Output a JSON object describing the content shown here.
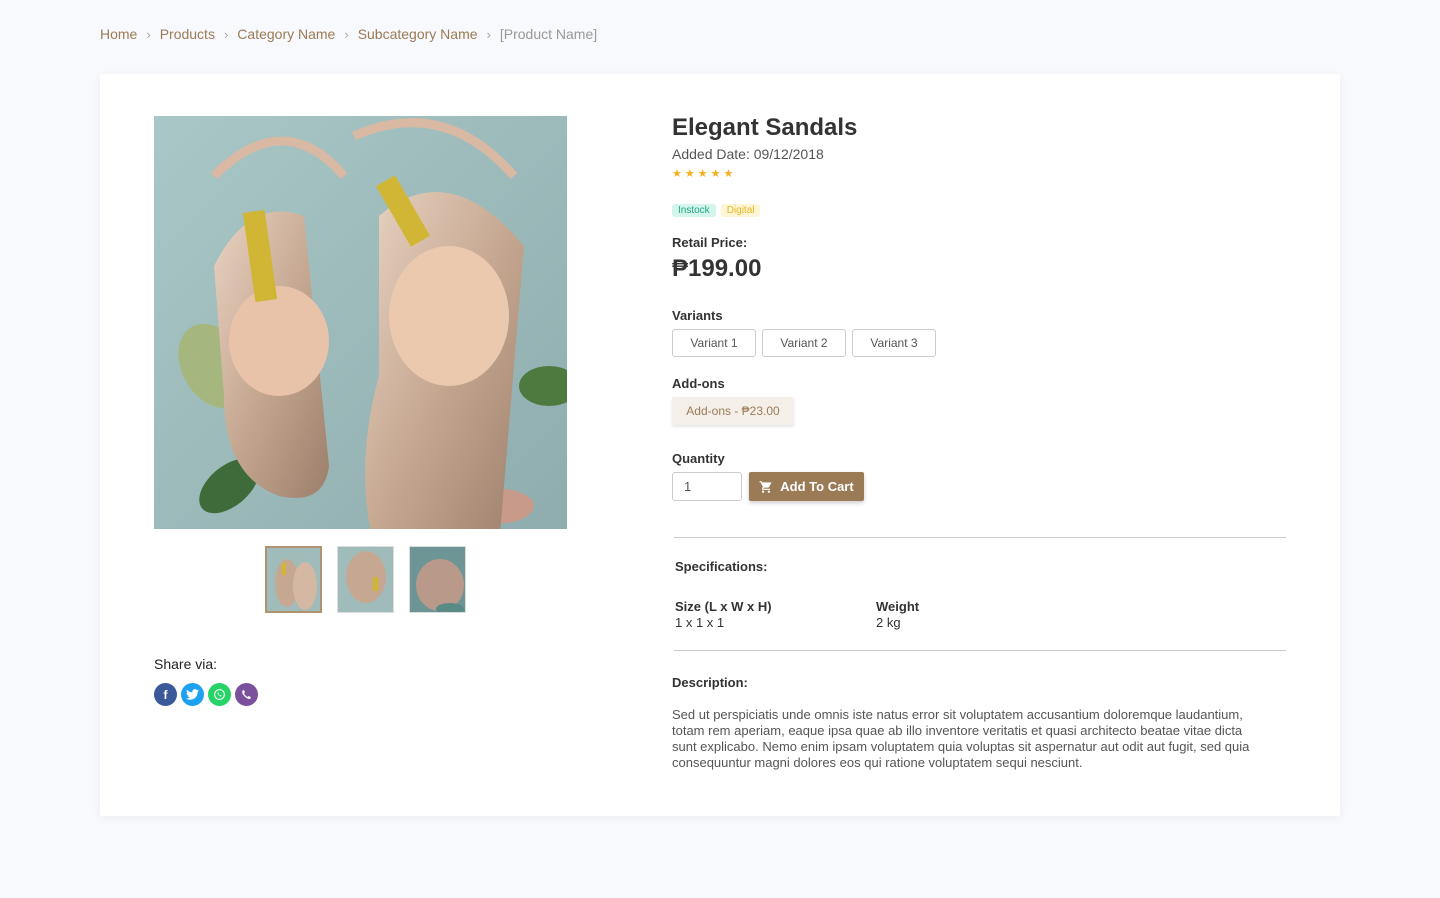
{
  "breadcrumb": {
    "items": [
      "Home",
      "Products",
      "Category Name",
      "Subcategory Name"
    ],
    "current": "[Product Name]",
    "separator": "›"
  },
  "product": {
    "title": "Elegant Sandals",
    "added_date": "Added Date: 09/12/2018",
    "rating": 5,
    "badges": [
      "Instock",
      "Digital"
    ],
    "retail_label": "Retail Price:",
    "price": "₱199.00",
    "variants_label": "Variants",
    "variants": [
      "Variant 1",
      "Variant 2",
      "Variant 3"
    ],
    "addons_label": "Add-ons",
    "addon": "Add-ons - ₱23.00",
    "quantity_label": "Quantity",
    "quantity_value": "1",
    "cart_button": "Add To Cart"
  },
  "specs": {
    "title": "Specifications:",
    "size_label": "Size (L x W x H)",
    "size_value": "1 x 1 x 1",
    "weight_label": "Weight",
    "weight_value": "2 kg"
  },
  "description": {
    "title": "Description:",
    "text": "Sed ut perspiciatis unde omnis iste natus error sit voluptatem accusantium doloremque laudantium, totam rem aperiam, eaque ipsa quae ab illo inventore veritatis et quasi architecto beatae vitae dicta sunt explicabo. Nemo enim ipsam voluptatem quia voluptas sit aspernatur aut odit aut fugit, sed quia consequuntur magni dolores eos qui ratione voluptatem sequi nesciunt."
  },
  "share": {
    "label": "Share via:",
    "icons": [
      "facebook-icon",
      "twitter-icon",
      "whatsapp-icon",
      "viber-icon"
    ]
  },
  "colors": {
    "accent": "#9a7b56",
    "star": "#f6b01e",
    "instock": "#1fa884",
    "digital": "#e8b51f"
  }
}
